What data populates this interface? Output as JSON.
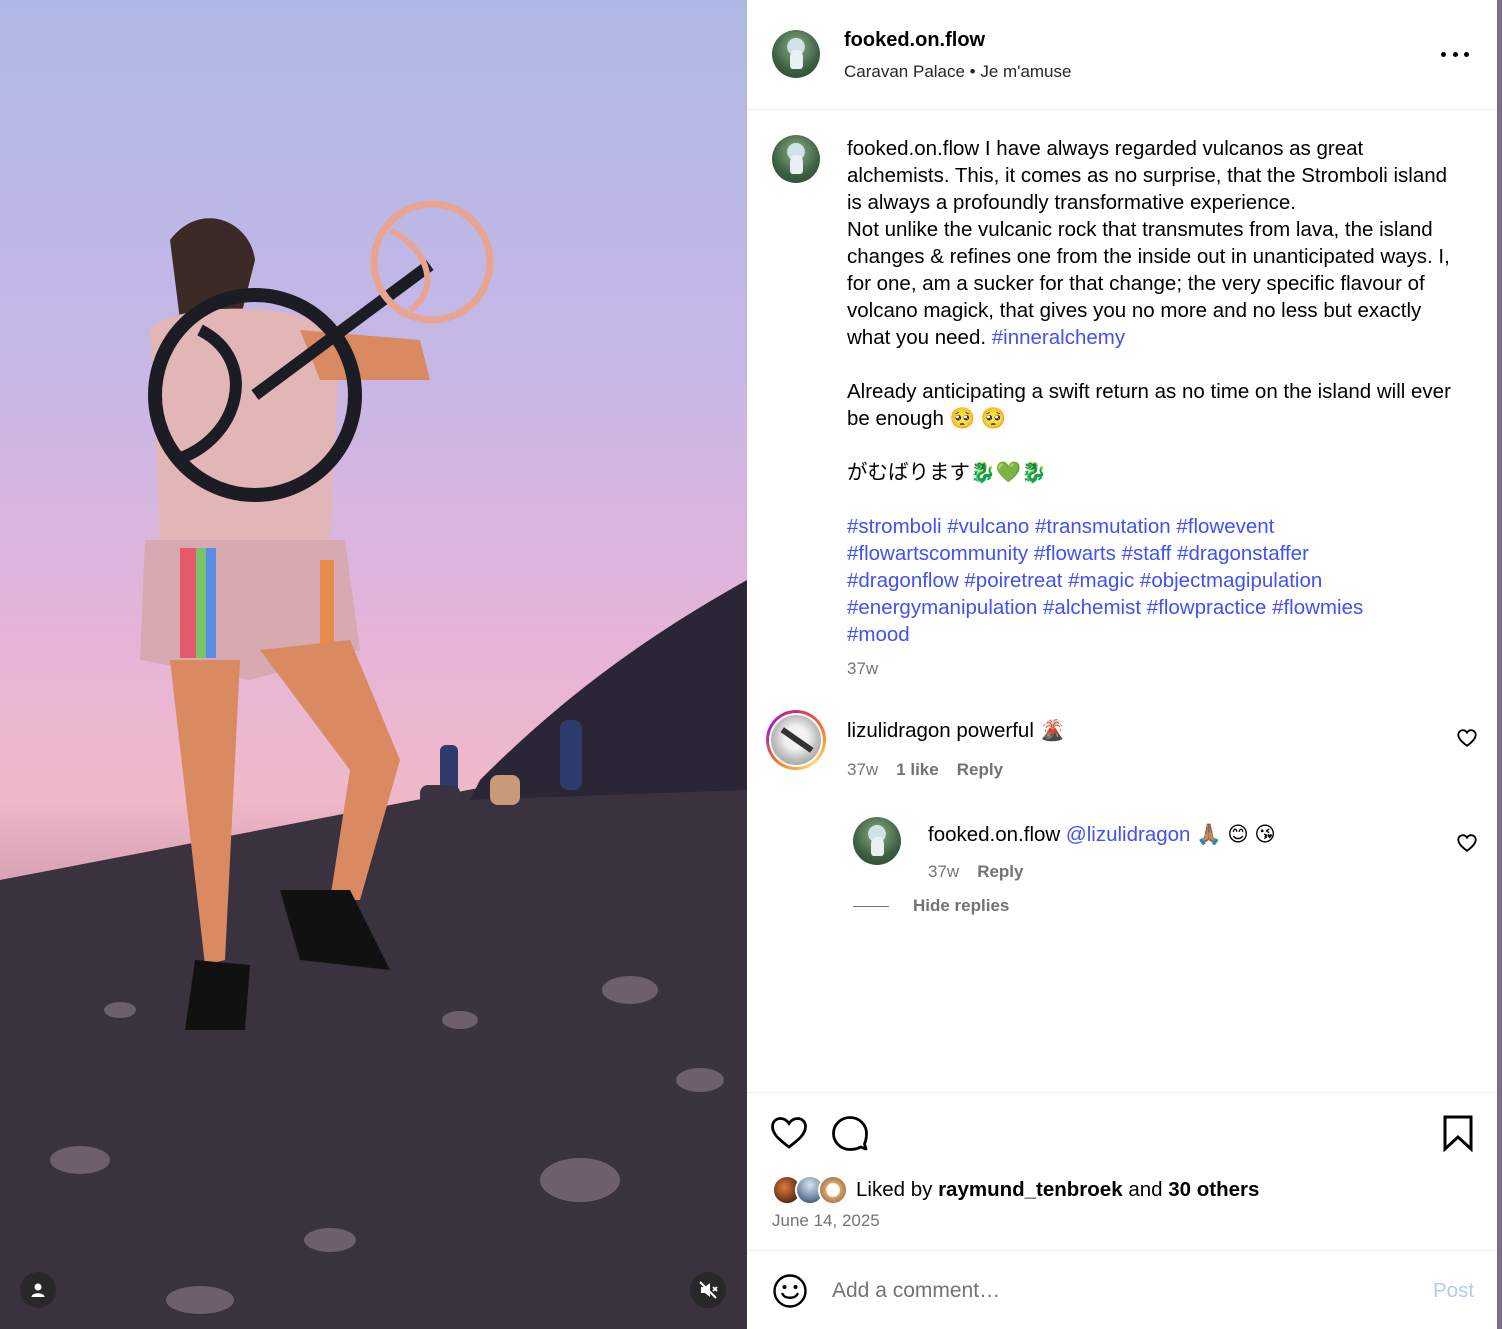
{
  "post": {
    "username": "fooked.on.flow",
    "audio": "Caravan Palace • Je m'amuse",
    "caption_user": "fooked.on.flow",
    "caption_body": " I have always regarded vulcanos as great alchemists. This, it comes as no surprise, that the Stromboli island is always a profoundly transformative experience.\nNot unlike the vulcanic rock that transmutes from lava, the island changes & refines one from the inside out in unanticipated ways. I, for one, am a sucker for that change; the very specific flavour of volcano magick, that gives you no more and no less but exactly what you need. ",
    "caption_tag": "#inneralchemy",
    "caption_para2": "\n\nAlready anticipating a swift return as no time on the island will ever be enough 🥺 🥺\n\nがむばります🐉💚🐉\n\n",
    "hashtags": [
      "#stromboli",
      "#vulcano",
      "#transmutation",
      "#flowevent",
      "#flowartscommunity",
      "#flowarts",
      "#staff",
      "#dragonstaffer",
      "#dragonflow",
      "#poiretreat",
      "#magic",
      "#objectmagipulation",
      "#energymanipulation",
      "#alchemist",
      "#flowpractice",
      "#flowmies",
      "#mood"
    ],
    "time": "37w"
  },
  "comments": [
    {
      "username": "lizulidragon",
      "text": "powerful 🌋",
      "time": "37w",
      "likes": "1 like",
      "reply": "Reply"
    }
  ],
  "replies": [
    {
      "username": "fooked.on.flow",
      "mention": "@lizulidragon",
      "text": "🙏🏽 😊 😘",
      "time": "37w",
      "reply": "Reply"
    }
  ],
  "hide_replies": "Hide replies",
  "likes": {
    "prefix": "Liked by ",
    "user": "raymund_tenbroek",
    "mid": " and ",
    "others": "30 others"
  },
  "date": "June 14, 2025",
  "add_comment": {
    "placeholder": "Add a comment…",
    "post_label": "Post"
  },
  "icons": {
    "more": "more-options-icon",
    "like": "heart-icon",
    "comment": "comment-bubble-icon",
    "save": "bookmark-icon",
    "emoji": "emoji-smiley-icon",
    "tag": "user-tag-icon",
    "mute": "volume-muted-icon"
  },
  "colors": {
    "link": "#4150f7",
    "secondary_text": "#737373",
    "post_button_disabled": "#b3c9f5"
  }
}
